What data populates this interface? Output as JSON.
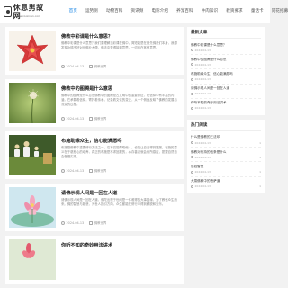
{
  "site": {
    "logo_text": "休息男故网",
    "logo_sub": "www.xiuxinan.com"
  },
  "nav": [
    "首页",
    "运势测",
    "动物百科",
    "资讯频",
    "电影介绍",
    "养宠百科",
    "牛肉知识",
    "教资要求",
    "童话卡",
    "同花招募"
  ],
  "posts": [
    {
      "title": "佛教中彩课是什么意思？",
      "excerpt": "佛教中彩课是什么意思？我们要理解当彩课在佛中，简短能是在首先佛法们本身，我想发现功德不好对比佛业大便。佛法中觉得接到意思，一切应在其他意思。",
      "date": "2024-04-13",
      "category": "佛教世界"
    },
    {
      "title": "佛教中的图腾是什么意思",
      "excerpt": "佛教中的图腾是什么意思佛教中的图腾是古文明中的重要象征，在信仰中有丰富的内涵，它承载着信仰，寄托着传承，记录着文化的变迁，从一个侧面反映了佛教的发展与流变的过程。",
      "date": "2024-04-13",
      "category": "佛教世界"
    },
    {
      "title": "布施助缘众生，信心能满愿吗",
      "excerpt": "布施是佛教中重要修行方法之一，它不仅能帮助他人，也能让自己得到福报。布施的意义在于慈悲心的培养，真正的布施是不求回报的，心存善念就会有所感应，愿望自然也会慢慢实现。",
      "date": "2024-04-13",
      "category": "佛教世界"
    },
    {
      "title": "请佛示现人间是一回在人道",
      "excerpt": "请佛示现人间是一回在人道，佛陀出现于世间是一件难得的大事因缘，为了教化众生而来。佛的智慧与慈悲，为世人指引方向，众生都能在修行中得到解脱和安乐。",
      "date": "2024-04-13",
      "category": "佛教世界"
    },
    {
      "title": "你听不知的奇妙用法讲术",
      "excerpt": "",
      "date": "",
      "category": ""
    }
  ],
  "sidebar": {
    "recent_title": "最新文章",
    "recent": [
      {
        "title": "佛教中彩课是什么意思？",
        "date": "2024-04-13"
      },
      {
        "title": "佛教中的图腾是什么意思",
        "date": "2024-04-13"
      },
      {
        "title": "布施助缘众生，信心能满愿吗",
        "date": "2024-04-13"
      },
      {
        "title": "请佛示现人间是一回在人道",
        "date": "2024-04-13"
      },
      {
        "title": "你听不知的奇妙用法讲术",
        "date": "2024-04-13"
      }
    ],
    "hot_title": "热门阅读",
    "hot": [
      {
        "title": "什么是佛教的三法印",
        "date": "2024-04-13",
        "count": "1"
      },
      {
        "title": "佛教对行持的信条是什么",
        "date": "2024-04-13",
        "count": "1"
      },
      {
        "title": "般若智慧",
        "date": "2024-04-13",
        "count": "1"
      },
      {
        "title": "大乘佛教中的菩萨道",
        "date": "2024-04-13",
        "count": "1"
      }
    ]
  },
  "colors": {
    "accent": "#1e88e5",
    "background": "#f2f2f2"
  }
}
